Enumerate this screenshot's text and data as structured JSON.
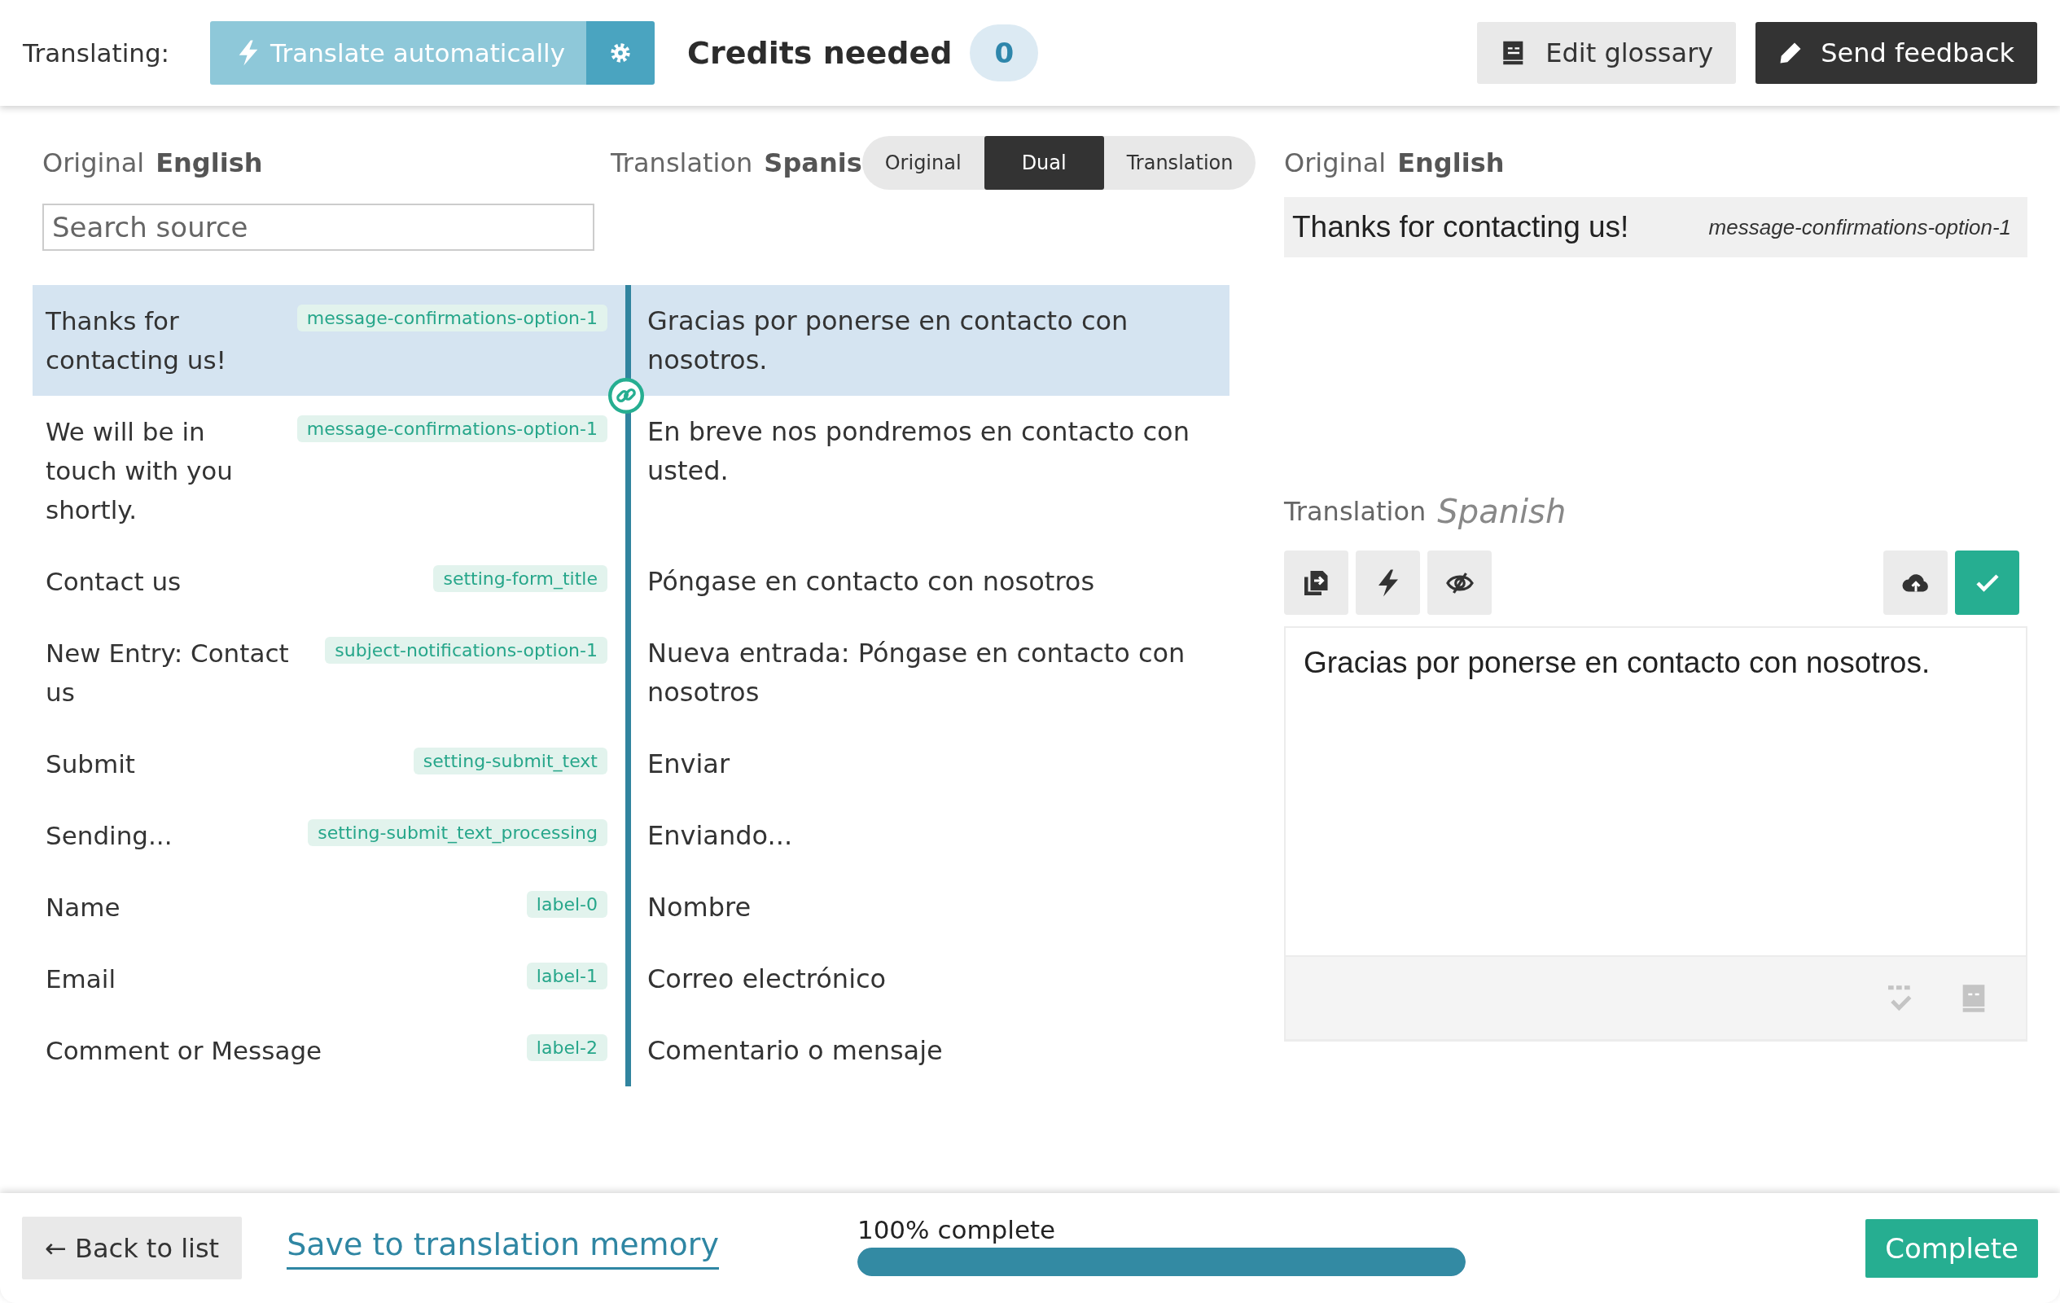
{
  "toolbar": {
    "label": "Translating:",
    "auto_button": "Translate automatically",
    "credits_label": "Credits needed",
    "credits": "0",
    "glossary_button": "Edit glossary",
    "feedback_button": "Send feedback"
  },
  "source_header": {
    "label": "Original",
    "language": "English"
  },
  "target_header": {
    "label": "Translation",
    "language": "Spanis"
  },
  "view_modes": [
    {
      "label": "Original",
      "selected": false
    },
    {
      "label": "Dual",
      "selected": true
    },
    {
      "label": "Translation",
      "selected": false
    }
  ],
  "search": {
    "placeholder": "Search source"
  },
  "rows": [
    {
      "source": "Thanks for contacting us!",
      "key": "message-confirmations-option-1",
      "translation": "Gracias por ponerse en contacto con nosotros.",
      "selected": true
    },
    {
      "source": "We will be in touch with you shortly.",
      "key": "message-confirmations-option-1",
      "translation": "En breve nos pondremos en contacto con usted.",
      "selected": false
    },
    {
      "source": "Contact us",
      "key": "setting-form_title",
      "translation": "Póngase en contacto con nosotros",
      "selected": false
    },
    {
      "source": "New Entry: Contact us",
      "key": "subject-notifications-option-1",
      "translation": "Nueva entrada: Póngase en contacto con nosotros",
      "selected": false
    },
    {
      "source": "Submit",
      "key": "setting-submit_text",
      "translation": "Enviar",
      "selected": false
    },
    {
      "source": "Sending...",
      "key": "setting-submit_text_processing",
      "translation": "Enviando...",
      "selected": false
    },
    {
      "source": "Name",
      "key": "label-0",
      "translation": "Nombre",
      "selected": false
    },
    {
      "source": "Email",
      "key": "label-1",
      "translation": "Correo electrónico",
      "selected": false
    },
    {
      "source": "Comment or Message",
      "key": "label-2",
      "translation": "Comentario o mensaje",
      "selected": false
    }
  ],
  "detail": {
    "original_label": "Original",
    "original_language": "English",
    "source_text": "Thanks for contacting us!",
    "source_key": "message-confirmations-option-1",
    "translation_label": "Translation",
    "translation_language": "Spanish",
    "translation_value": "Gracias por ponerse en contacto con nosotros."
  },
  "footer": {
    "back_button": "← Back to list",
    "save_link": "Save to translation memory",
    "progress_label": "100% complete",
    "progress": {
      "level": 1
    },
    "complete_button": "Complete"
  }
}
